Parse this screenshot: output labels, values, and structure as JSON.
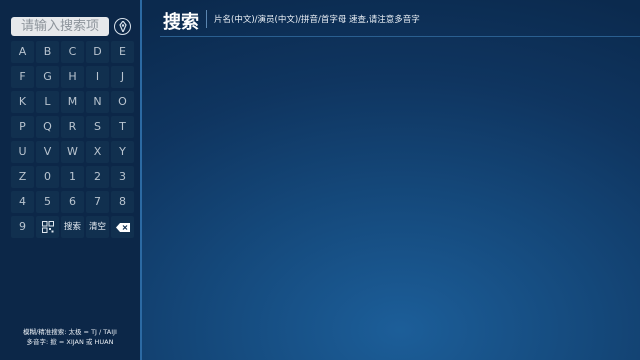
{
  "search": {
    "placeholder": "请输入搜索项"
  },
  "keypad": {
    "rows": [
      [
        "A",
        "B",
        "C",
        "D",
        "E"
      ],
      [
        "F",
        "G",
        "H",
        "I",
        "J"
      ],
      [
        "K",
        "L",
        "M",
        "N",
        "O"
      ],
      [
        "P",
        "Q",
        "R",
        "S",
        "T"
      ],
      [
        "U",
        "V",
        "W",
        "X",
        "Y"
      ],
      [
        "Z",
        "0",
        "1",
        "2",
        "3"
      ],
      [
        "4",
        "5",
        "6",
        "7",
        "8"
      ]
    ],
    "last_row": {
      "digit": "9",
      "search_label": "搜索",
      "clear_label": "清空"
    }
  },
  "header": {
    "title": "搜索",
    "subtitle": "片名(中文)/演员(中文)/拼音/首字母 速查,请注意多音字"
  },
  "hints": {
    "line1": "模糊/精准搜索: 太极 = TJ / TAIJI",
    "line2": "多音字: 掀 = XIJAN 或 HUAN"
  },
  "icons": {
    "voice": "voice-icon",
    "qrcode": "qrcode-icon",
    "backspace": "backspace-icon"
  },
  "colors": {
    "background": "#154a7d",
    "sidebar": "#0c2748",
    "key": "#11304f",
    "accent": "#2c6aa3"
  }
}
